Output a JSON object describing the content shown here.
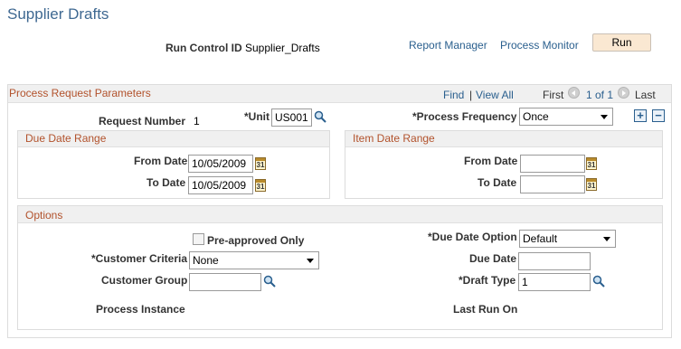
{
  "page": {
    "title": "Supplier Drafts"
  },
  "run_bar": {
    "run_control_label": "Run Control ID",
    "run_control_value": "Supplier_Drafts",
    "report_manager": "Report Manager",
    "process_monitor": "Process Monitor",
    "run_button": "Run"
  },
  "params": {
    "header": "Process Request Parameters",
    "find": "Find",
    "separator": "|",
    "view_all": "View All",
    "first": "First",
    "pager": "1 of 1",
    "last": "Last",
    "request_number_label": "Request Number",
    "request_number_value": "1",
    "unit_label": "*Unit",
    "unit_value": "US001",
    "process_frequency_label": "*Process Frequency",
    "process_frequency_value": "Once",
    "add_row": "+",
    "delete_row": "−"
  },
  "due_date_range": {
    "header": "Due Date Range",
    "from_label": "From Date",
    "from_value": "10/05/2009",
    "to_label": "To Date",
    "to_value": "10/05/2009"
  },
  "item_date_range": {
    "header": "Item Date Range",
    "from_label": "From Date",
    "from_value": "",
    "to_label": "To Date",
    "to_value": ""
  },
  "options": {
    "header": "Options",
    "preapproved_label": "Pre-approved Only",
    "preapproved_checked": false,
    "customer_criteria_label": "*Customer Criteria",
    "customer_criteria_value": "None",
    "customer_group_label": "Customer Group",
    "customer_group_value": "",
    "process_instance_label": "Process Instance",
    "due_date_option_label": "*Due Date Option",
    "due_date_option_value": "Default",
    "due_date_label": "Due Date",
    "due_date_value": "",
    "draft_type_label": "*Draft Type",
    "draft_type_value": "1",
    "last_run_on_label": "Last Run On"
  },
  "icons": {
    "calendar_glyph": "31"
  },
  "colors": {
    "title": "#3e6891",
    "section_header": "#b2522c",
    "link": "#2a5f8e",
    "run_button_bg": "#fae8d2",
    "header_bg": "#f0f0f0"
  }
}
